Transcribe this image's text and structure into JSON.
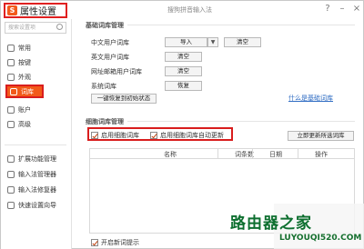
{
  "title": "属性设置",
  "window_title": "搜狗拼音输入法",
  "window_controls": [
    "?",
    "–",
    "×"
  ],
  "search": {
    "placeholder": "搜索设置项"
  },
  "sidebar": {
    "items": [
      {
        "label": "常用",
        "icon": "settings-icon"
      },
      {
        "label": "按键",
        "icon": "key-icon"
      },
      {
        "label": "外观",
        "icon": "shirt-icon"
      },
      {
        "label": "词库",
        "icon": "dictionary-icon",
        "active": true
      },
      {
        "label": "账户",
        "icon": "user-icon"
      },
      {
        "label": "高级",
        "icon": "gear-icon"
      }
    ],
    "tools": [
      {
        "label": "扩展功能管理",
        "icon": "extension-icon"
      },
      {
        "label": "输入法管理器",
        "icon": "manager-icon"
      },
      {
        "label": "输入法修复器",
        "icon": "repair-icon"
      },
      {
        "label": "快速设置向导",
        "icon": "wizard-icon"
      }
    ]
  },
  "basic": {
    "title": "基础词库管理",
    "rows": [
      {
        "label": "中文用户词库",
        "btn1": "导入",
        "btn2": "清空"
      },
      {
        "label": "英文用户词库",
        "btn1": "清空"
      },
      {
        "label": "网址邮箱用户词库",
        "btn1": "清空"
      },
      {
        "label": "系统词库",
        "btn1": "恢复"
      }
    ],
    "restore_btn": "一键恢复到初始状态",
    "help_link": "什么是基础词库"
  },
  "cloud": {
    "title": "细胞词库管理",
    "enable": "启用细胞词库",
    "auto_update": "启用细胞词库自动更新",
    "update_btn": "立即更新所选词库",
    "columns": [
      "名称",
      "词条数",
      "日期",
      "操作"
    ]
  },
  "footer": {
    "startup_tip": "开启新词提示"
  },
  "watermark": {
    "logo": "路由器之家",
    "url": "LUYOUQI520.COM"
  }
}
